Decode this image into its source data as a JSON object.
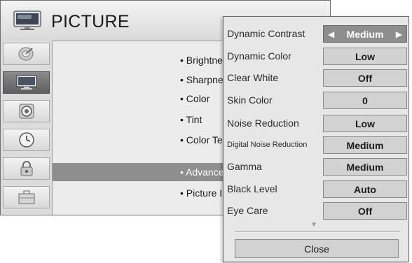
{
  "header": {
    "title": "PICTURE",
    "icon": "tv-icon"
  },
  "sidebar": {
    "items": [
      {
        "name": "satellite-dish-icon",
        "selected": false
      },
      {
        "name": "tv-icon",
        "selected": true
      },
      {
        "name": "speaker-icon",
        "selected": false
      },
      {
        "name": "clock-icon",
        "selected": false
      },
      {
        "name": "lock-icon",
        "selected": false
      },
      {
        "name": "briefcase-icon",
        "selected": false
      }
    ]
  },
  "menu": {
    "items": [
      {
        "label": "• Brightne",
        "selected": false
      },
      {
        "label": "• Sharpne",
        "selected": false
      },
      {
        "label": "• Color",
        "selected": false
      },
      {
        "label": "• Tint",
        "selected": false
      },
      {
        "label": "• Color Te",
        "selected": false
      },
      {
        "label": "• Advance",
        "selected": true
      },
      {
        "label": "• Picture I",
        "selected": false
      }
    ]
  },
  "popup": {
    "rows": [
      {
        "label": "Dynamic Contrast",
        "value": "Medium",
        "selected": true
      },
      {
        "label": "Dynamic Color",
        "value": "Low",
        "selected": false
      },
      {
        "label": "Clear White",
        "value": "Off",
        "selected": false
      },
      {
        "label": "Skin Color",
        "value": "0",
        "selected": false
      },
      {
        "label": "Noise Reduction",
        "value": "Low",
        "selected": false
      },
      {
        "label": "Digital Noise Reduction",
        "value": "Medium",
        "selected": false
      },
      {
        "label": "Gamma",
        "value": "Medium",
        "selected": false
      },
      {
        "label": "Black Level",
        "value": "Auto",
        "selected": false
      },
      {
        "label": "Eye Care",
        "value": "Off",
        "selected": false
      }
    ],
    "scroll_indicator": "▼",
    "left_arrow": "◀",
    "right_arrow": "▶",
    "close_label": "Close"
  },
  "colors": {
    "selected_bg": "#8e8e8e",
    "panel_bg": "#ececec",
    "value_bg": "#d2d2d2"
  }
}
